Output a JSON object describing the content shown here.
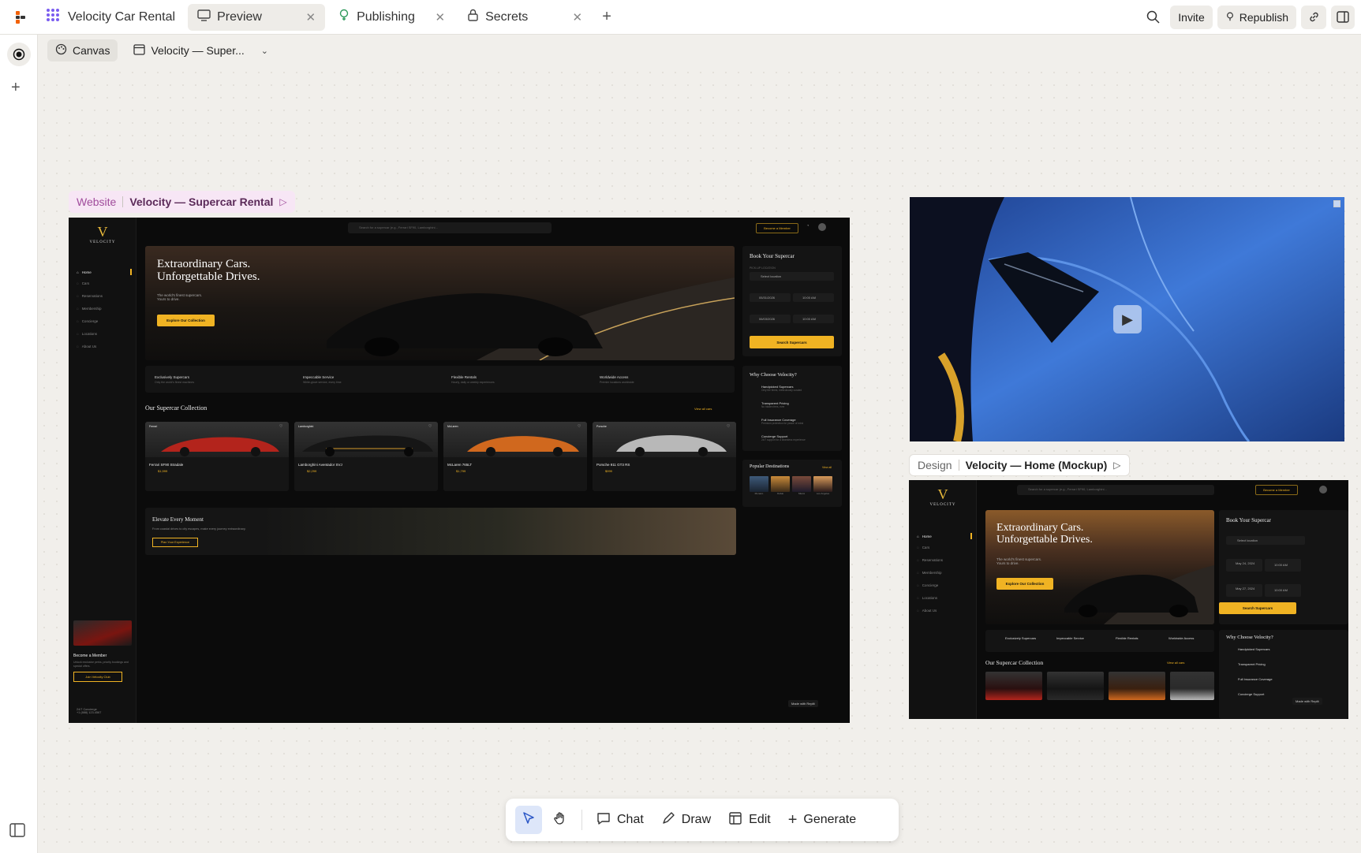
{
  "app": {
    "title": "Velocity Car Rental"
  },
  "tabs": [
    {
      "label": "Preview",
      "icon": "monitor-icon",
      "active": true
    },
    {
      "label": "Publishing",
      "icon": "publish-icon",
      "active": false
    },
    {
      "label": "Secrets",
      "icon": "lock-icon",
      "active": false
    }
  ],
  "topbar": {
    "invite": "Invite",
    "republish": "Republish"
  },
  "subbar": {
    "canvas": "Canvas",
    "page": "Velocity — Super..."
  },
  "frames": {
    "website": {
      "kind": "Website",
      "name": "Velocity — Supercar Rental"
    },
    "design": {
      "kind": "Design",
      "name": "Velocity — Home (Mockup)"
    }
  },
  "site": {
    "brand": "VELOCITY",
    "search_placeholder": "Search for a supercar (e.g., Ferrari SF90, Lamborghini...",
    "member_btn": "Become a Member",
    "nav": [
      "Home",
      "Cars",
      "Reservations",
      "Membership",
      "Concierge",
      "Locations",
      "About Us"
    ],
    "hero": {
      "line1": "Extraordinary Cars.",
      "line2": "Unforgettable Drives.",
      "sub1": "The world's finest supercars.",
      "sub2": "Yours to drive.",
      "cta": "Explore Our Collection"
    },
    "book": {
      "title": "Book Your Supercar",
      "pickup_label": "PICK-UP LOCATION",
      "pickup": "Select location",
      "pickup_date": "05/31/2026",
      "pickup_time": "10:00 AM",
      "return_date": "06/03/2026",
      "return_time": "10:00 AM",
      "search": "Search Supercars"
    },
    "features": [
      {
        "title": "Exclusively Supercars",
        "sub": "Only the world's finest machines"
      },
      {
        "title": "Impeccable Service",
        "sub": "White-glove service, every time"
      },
      {
        "title": "Flexible Rentals",
        "sub": "Hourly, daily or weekly experiences"
      },
      {
        "title": "Worldwide Access",
        "sub": "Premier locations worldwide"
      }
    ],
    "collection": {
      "title": "Our Supercar Collection",
      "view_all": "View all cars"
    },
    "cars": [
      {
        "brand": "Ferrari",
        "name": "Ferrari SF90 Stradale",
        "price": "$1,999",
        "color": "#b3241c"
      },
      {
        "brand": "Lamborghini",
        "name": "Lamborghini Aventador SVJ",
        "price": "$2,299",
        "color": "#2a2a2a"
      },
      {
        "brand": "McLaren",
        "name": "McLaren 765LT",
        "price": "$1,799",
        "color": "#d0681e"
      },
      {
        "brand": "Porsche",
        "name": "Porsche 911 GT3 RS",
        "price": "$999",
        "color": "#b8b8b8"
      }
    ],
    "why": {
      "title": "Why Choose Velocity?",
      "items": [
        {
          "title": "Handpicked Supercars",
          "sub": "Only the finest, meticulously curated"
        },
        {
          "title": "Transparent Pricing",
          "sub": "No hidden fees, ever"
        },
        {
          "title": "Full Insurance Coverage",
          "sub": "Premium protection for peace of mind"
        },
        {
          "title": "Concierge Support",
          "sub": "24/7 support for a seamless experience"
        }
      ]
    },
    "destinations": {
      "title": "Popular Destinations",
      "view_all": "View all",
      "items": [
        "Monaco",
        "Dubai",
        "Miami",
        "Los Angeles"
      ]
    },
    "elevate": {
      "title": "Elevate Every Moment",
      "sub": "From coastal drives to city escapes, make every journey extraordinary.",
      "cta": "Plan Your Experience"
    },
    "member_card": {
      "title": "Become a Member",
      "sub": "Unlock exclusive perks, priority bookings and special offers.",
      "cta": "Join Velocity Club"
    },
    "concierge": {
      "title": "24/7 Concierge",
      "sub": "+1 (888) 123-4567"
    },
    "made_with": "Made with Replit"
  },
  "design": {
    "pickup_date": "May 24, 2024",
    "return_date": "May 27, 2024",
    "time": "10:00 AM"
  },
  "toolbar": {
    "chat": "Chat",
    "draw": "Draw",
    "edit": "Edit",
    "generate": "Generate"
  },
  "colors": {
    "gold": "#f0b323",
    "dark": "#0b0b0b",
    "accent": "#3b6fd8"
  }
}
